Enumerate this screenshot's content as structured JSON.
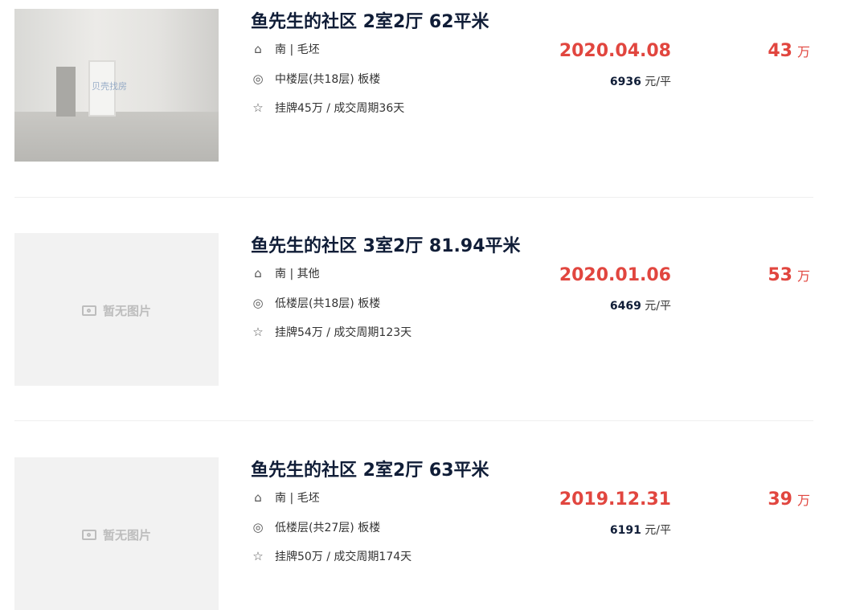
{
  "icons": {
    "orientation": "house-icon",
    "floor": "location-pin-icon",
    "deal": "star-outline-icon",
    "camera": "camera-icon"
  },
  "colors": {
    "accent": "#e1463f",
    "title": "#101d37",
    "placeholder_bg": "#f2f2f2"
  },
  "listings": [
    {
      "title": "鱼先生的社区 2室2厅 62平米",
      "house_info": "南 | 毛坯",
      "position_info": "中楼层(共18层) 板楼",
      "deal_info": "挂牌45万 / 成交周期36天",
      "deal_date": "2020.04.08",
      "unit_price_value": "6936",
      "unit_price_unit": "元/平",
      "total_price": "43",
      "total_unit": "万",
      "image_watermark": "贝壳找房",
      "image_placeholder": ""
    },
    {
      "title": "鱼先生的社区 3室2厅 81.94平米",
      "house_info": "南 | 其他",
      "position_info": "低楼层(共18层) 板楼",
      "deal_info": "挂牌54万 / 成交周期123天",
      "deal_date": "2020.01.06",
      "unit_price_value": "6469",
      "unit_price_unit": "元/平",
      "total_price": "53",
      "total_unit": "万",
      "image_placeholder": "暂无图片"
    },
    {
      "title": "鱼先生的社区 2室2厅 63平米",
      "house_info": "南 | 毛坯",
      "position_info": "低楼层(共27层) 板楼",
      "deal_info": "挂牌50万 / 成交周期174天",
      "deal_date": "2019.12.31",
      "unit_price_value": "6191",
      "unit_price_unit": "元/平",
      "total_price": "39",
      "total_unit": "万",
      "image_placeholder": "暂无图片"
    }
  ]
}
